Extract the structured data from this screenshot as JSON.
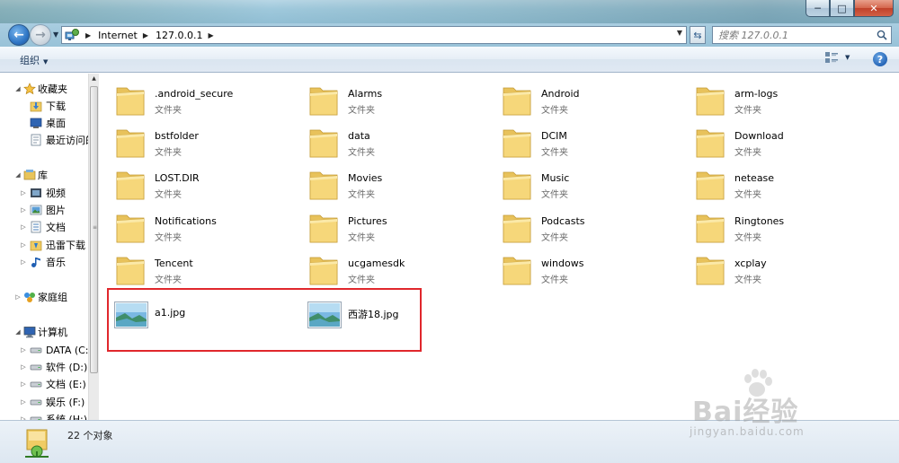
{
  "window": {
    "controls": {
      "minimize": "─",
      "maximize": "□",
      "close": "✕"
    }
  },
  "address_bar": {
    "crumbs": [
      "Internet",
      "127.0.0.1"
    ],
    "search_placeholder": "搜索 127.0.0.1"
  },
  "command_bar": {
    "organize_label": "组织"
  },
  "nav_pane": {
    "favorites": {
      "label": "收藏夹",
      "items": [
        "下载",
        "桌面",
        "最近访问的位置"
      ]
    },
    "libraries": {
      "label": "库",
      "items": [
        "视频",
        "图片",
        "文档",
        "迅雷下载",
        "音乐"
      ]
    },
    "homegroup": {
      "label": "家庭组"
    },
    "computer": {
      "label": "计算机",
      "items": [
        "DATA (C:)",
        "软件 (D:)",
        "文档 (E:)",
        "娱乐 (F:)",
        "系统 (H:)"
      ]
    }
  },
  "content": {
    "folder_type_label": "文件夹",
    "folders": [
      ".android_secure",
      "Alarms",
      "Android",
      "arm-logs",
      "bstfolder",
      "data",
      "DCIM",
      "Download",
      "LOST.DIR",
      "Movies",
      "Music",
      "netease",
      "Notifications",
      "Pictures",
      "Podcasts",
      "Ringtones",
      "Tencent",
      "ucgamesdk",
      "windows",
      "xcplay"
    ],
    "images": [
      "a1.jpg",
      "西游18.jpg"
    ]
  },
  "status_bar": {
    "count_text": "22 个对象"
  },
  "watermark": {
    "logo_text": "Bai经验",
    "url_text": "jingyan.baidu.com"
  },
  "colors": {
    "highlight_border": "#e0272c",
    "folder_yellow": "#f2cf6b"
  }
}
